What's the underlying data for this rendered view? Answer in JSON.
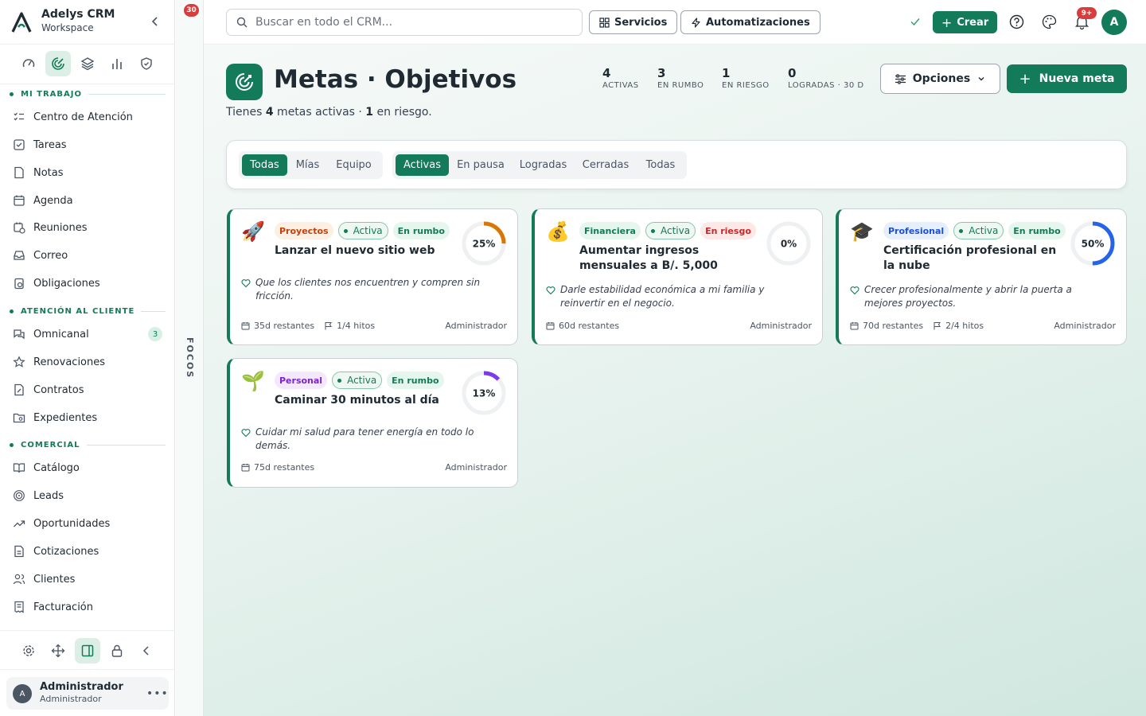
{
  "brand": {
    "name": "Adelys CRM",
    "workspace": "Workspace"
  },
  "sidebar": {
    "sections": [
      {
        "label": "MI TRABAJO",
        "items": [
          {
            "label": "Centro de Atención",
            "icon": "list-check-icon"
          },
          {
            "label": "Tareas",
            "icon": "checkbox-icon"
          },
          {
            "label": "Notas",
            "icon": "note-icon"
          },
          {
            "label": "Agenda",
            "icon": "calendar-icon"
          },
          {
            "label": "Reuniones",
            "icon": "calendar-clock-icon"
          },
          {
            "label": "Correo",
            "icon": "inbox-icon"
          },
          {
            "label": "Obligaciones",
            "icon": "clipboard-icon"
          }
        ]
      },
      {
        "label": "ATENCIÓN AL CLIENTE",
        "items": [
          {
            "label": "Omnicanal",
            "icon": "chat-icon",
            "count": "3"
          },
          {
            "label": "Renovaciones",
            "icon": "star-icon"
          },
          {
            "label": "Contratos",
            "icon": "contract-icon"
          },
          {
            "label": "Expedientes",
            "icon": "folder-icon"
          }
        ]
      },
      {
        "label": "COMERCIAL",
        "items": [
          {
            "label": "Catálogo",
            "icon": "book-icon"
          },
          {
            "label": "Leads",
            "icon": "target-icon"
          },
          {
            "label": "Oportunidades",
            "icon": "trending-up-icon"
          },
          {
            "label": "Cotizaciones",
            "icon": "document-icon"
          },
          {
            "label": "Clientes",
            "icon": "users-icon"
          },
          {
            "label": "Facturación",
            "icon": "receipt-icon"
          }
        ]
      }
    ]
  },
  "user": {
    "initial": "A",
    "name": "Administrador",
    "role": "Administrador"
  },
  "focos": {
    "label": "FOCOS",
    "badge": "30"
  },
  "topbar": {
    "search_placeholder": "Buscar en todo el CRM...",
    "servicios": "Servicios",
    "automatizaciones": "Automatizaciones",
    "crear": "Crear",
    "notif_badge": "9+",
    "avatar": "A"
  },
  "page": {
    "title": "Metas · Objetivos",
    "subtitle_pre": "Tienes ",
    "active_count": "4",
    "subtitle_mid": " metas activas · ",
    "risk_count": "1",
    "subtitle_post": " en riesgo.",
    "stats": [
      {
        "value": "4",
        "label": "ACTIVAS"
      },
      {
        "value": "3",
        "label": "EN RUMBO"
      },
      {
        "value": "1",
        "label": "EN RIESGO"
      },
      {
        "value": "0",
        "label": "LOGRADAS · 30 D"
      }
    ],
    "opciones": "Opciones",
    "nueva": "Nueva meta"
  },
  "filters": {
    "owner": [
      {
        "label": "Todas",
        "active": true
      },
      {
        "label": "Mías"
      },
      {
        "label": "Equipo"
      }
    ],
    "status": [
      {
        "label": "Activas",
        "active": true
      },
      {
        "label": "En pausa"
      },
      {
        "label": "Logradas"
      },
      {
        "label": "Cerradas"
      },
      {
        "label": "Todas"
      }
    ]
  },
  "goals": [
    {
      "emoji": "🚀",
      "category": "Proyectos",
      "cat_color": "#c2410c",
      "cat_bg": "#fdf0e3",
      "status": "Activa",
      "health": "En rumbo",
      "title": "Lanzar el nuevo sitio web",
      "progress": 0.25,
      "progress_label": "25%",
      "ring_color": "#d97706",
      "why": "Que los clientes nos encuentren y compren sin fricción.",
      "remaining": "35d restantes",
      "milestones": "1/4 hitos",
      "owner": "Administrador"
    },
    {
      "emoji": "💰",
      "category": "Financiera",
      "cat_color": "#137a5a",
      "cat_bg": "#e5f6ee",
      "status": "Activa",
      "health": "En riesgo",
      "title": "Aumentar ingresos mensuales a B/. 5,000",
      "progress": 0,
      "progress_label": "0%",
      "ring_color": "#16a34a",
      "why": "Darle estabilidad económica a mi familia y reinvertir en el negocio.",
      "remaining": "60d restantes",
      "owner": "Administrador"
    },
    {
      "emoji": "🎓",
      "category": "Profesional",
      "cat_color": "#1d4ed8",
      "cat_bg": "#e6effd",
      "status": "Activa",
      "health": "En rumbo",
      "title": "Certificación profesional en la nube",
      "progress": 0.5,
      "progress_label": "50%",
      "ring_color": "#2563eb",
      "why": "Crecer profesionalmente y abrir la puerta a mejores proyectos.",
      "remaining": "70d restantes",
      "milestones": "2/4 hitos",
      "owner": "Administrador"
    },
    {
      "emoji": "🌱",
      "category": "Personal",
      "cat_color": "#7e22ce",
      "cat_bg": "#f3e8fd",
      "status": "Activa",
      "health": "En rumbo",
      "title": "Caminar 30 minutos al día",
      "progress": 0.13,
      "progress_label": "13%",
      "ring_color": "#7c3aed",
      "why": "Cuidar mi salud para tener energía en todo lo demás.",
      "remaining": "75d restantes",
      "owner": "Administrador"
    }
  ]
}
